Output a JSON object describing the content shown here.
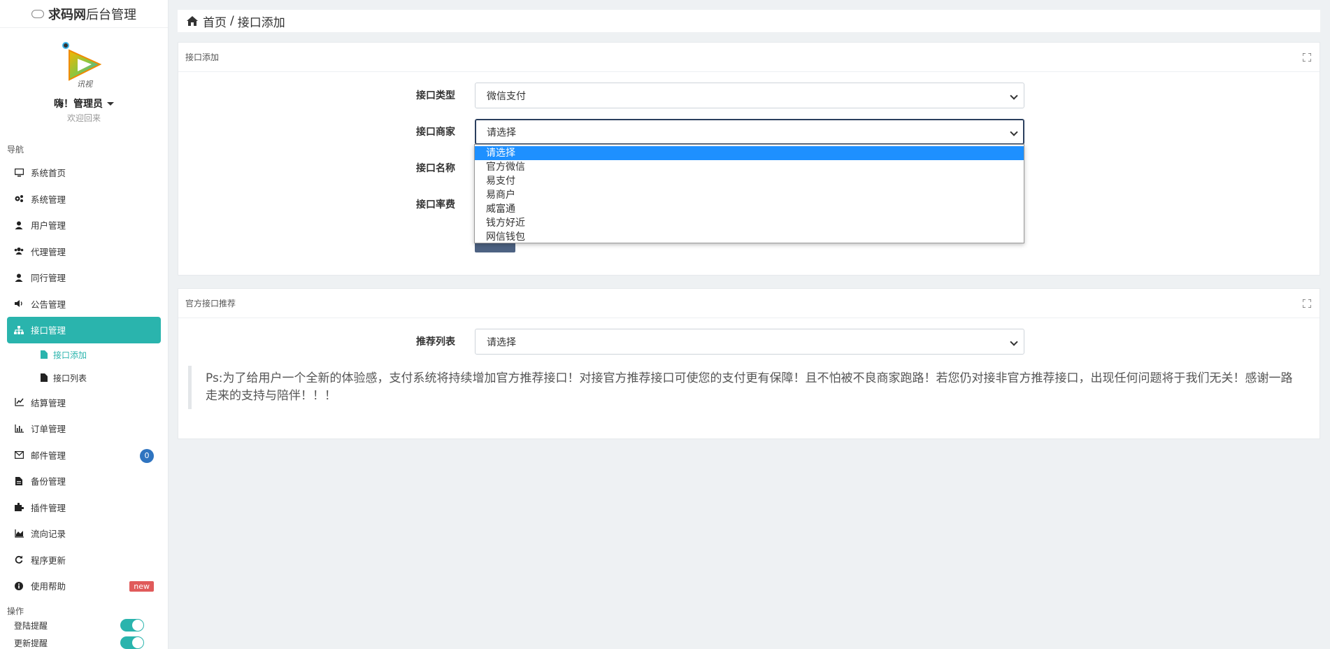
{
  "brand": {
    "bold": "求码网",
    "rest": "后台管理"
  },
  "user": {
    "greeting": "嗨！管理员",
    "welcome": "欢迎回来"
  },
  "nav": {
    "title": "导航",
    "items": [
      {
        "label": "系统首页",
        "icon": "desktop-icon"
      },
      {
        "label": "系统管理",
        "icon": "cogs-icon"
      },
      {
        "label": "用户管理",
        "icon": "user-icon"
      },
      {
        "label": "代理管理",
        "icon": "users-icon"
      },
      {
        "label": "同行管理",
        "icon": "user-icon"
      },
      {
        "label": "公告管理",
        "icon": "volume-icon"
      },
      {
        "label": "接口管理",
        "icon": "sitemap-icon"
      },
      {
        "label": "结算管理",
        "icon": "line-chart-icon"
      },
      {
        "label": "订单管理",
        "icon": "bar-chart-icon"
      },
      {
        "label": "邮件管理",
        "icon": "envelope-icon",
        "badge": "0"
      },
      {
        "label": "备份管理",
        "icon": "file-icon"
      },
      {
        "label": "插件管理",
        "icon": "puzzle-icon"
      },
      {
        "label": "流向记录",
        "icon": "area-chart-icon"
      },
      {
        "label": "程序更新",
        "icon": "refresh-icon"
      },
      {
        "label": "使用帮助",
        "icon": "info-icon",
        "badge": "new"
      }
    ],
    "sub_items": [
      {
        "label": "接口添加"
      },
      {
        "label": "接口列表"
      }
    ]
  },
  "ops": {
    "title": "操作",
    "items": [
      {
        "label": "登陆提醒",
        "on": true
      },
      {
        "label": "更新提醒",
        "on": true
      }
    ]
  },
  "breadcrumb": {
    "home": "首页",
    "sep": "/",
    "current": "接口添加"
  },
  "add_card": {
    "title": "接口添加",
    "fields": {
      "type_label": "接口类型",
      "type_value": "微信支付",
      "merchant_label": "接口商家",
      "merchant_value": "请选择",
      "name_label": "接口名称",
      "rate_label": "接口率费"
    },
    "dropdown_options": [
      "请选择",
      "官方微信",
      "易支付",
      "易商户",
      "威富通",
      "钱方好近",
      "网信钱包"
    ]
  },
  "rec_card": {
    "title": "官方接口推荐",
    "list_label": "推荐列表",
    "list_value": "请选择",
    "notice": "Ps:为了给用户一个全新的体验感，支付系统将持续增加官方推荐接口！对接官方推荐接口可使您的支付更有保障！且不怕被不良商家跑路！若您仍对接非官方推荐接口，出现任何问题将于我们无关！感谢一路走来的支持与陪伴！！！"
  },
  "colors": {
    "accent": "#2ab4ad",
    "badge_blue": "#2f74c0",
    "badge_red": "#e05a5a",
    "select_highlight": "#1e90ff"
  }
}
